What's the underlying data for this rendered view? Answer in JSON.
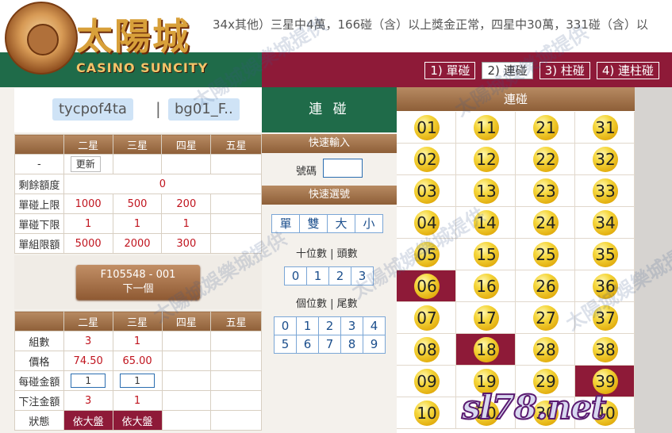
{
  "header": {
    "marquee": "34x其他）三星中4萬，166碰（含）以上獎金正常，四星中30萬，331碰（含）以",
    "logo_text": "太陽城",
    "logo_sub": "CASINO SUNCITY"
  },
  "tabs": [
    "1) 單碰",
    "2) 連碰",
    "3) 柱碰",
    "4) 連柱碰"
  ],
  "user": {
    "account": "tycpof4ta",
    "separator": "|",
    "game": "bg01_F.."
  },
  "limits_table": {
    "headers": [
      "",
      "二星",
      "三星",
      "四星",
      "五星"
    ],
    "refresh_label": "更新",
    "dash": "-",
    "rows": [
      {
        "label": "剩餘額度",
        "values": [
          "0"
        ]
      },
      {
        "label": "單碰上限",
        "values": [
          "1000",
          "500",
          "200",
          ""
        ]
      },
      {
        "label": "單碰下限",
        "values": [
          "1",
          "1",
          "1",
          ""
        ]
      },
      {
        "label": "單組限額",
        "values": [
          "5000",
          "2000",
          "300",
          ""
        ]
      }
    ]
  },
  "order": {
    "id": "F105548 - 001",
    "next": "下一個"
  },
  "bet_table": {
    "headers": [
      "",
      "二星",
      "三星",
      "四星",
      "五星"
    ],
    "rows": [
      {
        "label": "組數",
        "values": [
          "3",
          "1",
          "",
          ""
        ]
      },
      {
        "label": "價格",
        "values": [
          "74.50",
          "65.00",
          "",
          ""
        ]
      },
      {
        "label": "每碰金額",
        "values": [
          "1",
          "1",
          "",
          ""
        ]
      },
      {
        "label": "下注金額",
        "values": [
          "3",
          "1",
          "",
          ""
        ]
      },
      {
        "label": "狀態",
        "values": [
          "依大盤",
          "依大盤",
          "",
          ""
        ]
      }
    ]
  },
  "middle": {
    "title": "連 碰",
    "quick_input": "快速輸入",
    "number_label": "號碼",
    "quick_select": "快速選號",
    "parity": [
      "單",
      "雙",
      "大",
      "小"
    ],
    "tens_label": "十位數 | 頭數",
    "tens": [
      "0",
      "1",
      "2",
      "3"
    ],
    "units_label": "個位數 | 尾數",
    "units_row1": [
      "0",
      "1",
      "2",
      "3",
      "4"
    ],
    "units_row2": [
      "5",
      "6",
      "7",
      "8",
      "9"
    ]
  },
  "grid": {
    "title": "連碰",
    "numbers": [
      "01",
      "02",
      "03",
      "04",
      "05",
      "06",
      "07",
      "08",
      "09",
      "10",
      "11",
      "12",
      "13",
      "14",
      "15",
      "16",
      "17",
      "18",
      "19",
      "20",
      "21",
      "22",
      "23",
      "24",
      "25",
      "26",
      "27",
      "28",
      "29",
      "30",
      "31",
      "32",
      "33",
      "34",
      "35",
      "36",
      "37",
      "38",
      "39",
      "40"
    ],
    "selected": [
      "06",
      "18",
      "39"
    ]
  },
  "watermark_text": "太陽城娛樂城提供",
  "site_watermark": "sl78.net",
  "colors": {
    "green": "#1f6b49",
    "maroon": "#8e1a38",
    "brown": "#8e5f38",
    "ball": "#f5d63b"
  }
}
